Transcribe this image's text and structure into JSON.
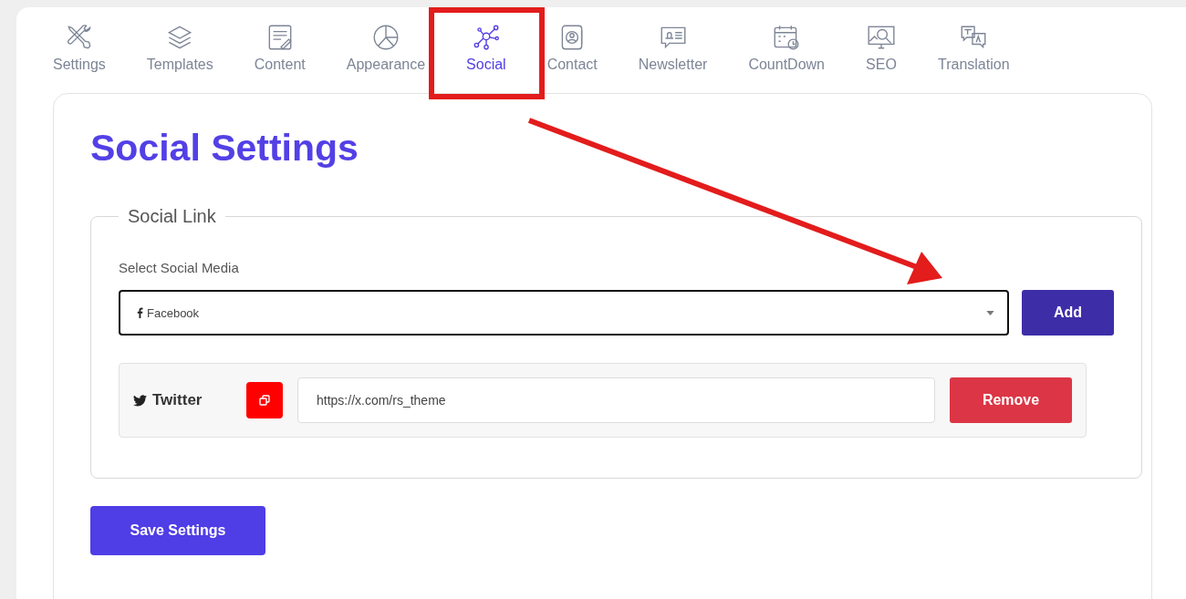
{
  "tabs": [
    {
      "label": "Settings",
      "selected": false
    },
    {
      "label": "Templates",
      "selected": false
    },
    {
      "label": "Content",
      "selected": false
    },
    {
      "label": "Appearance",
      "selected": false
    },
    {
      "label": "Social",
      "selected": true
    },
    {
      "label": "Contact",
      "selected": false
    },
    {
      "label": "Newsletter",
      "selected": false
    },
    {
      "label": "CountDown",
      "selected": false
    },
    {
      "label": "SEO",
      "selected": false
    },
    {
      "label": "Translation",
      "selected": false
    }
  ],
  "heading": "Social Settings",
  "social_link": {
    "legend": "Social Link",
    "select_label": "Select Social Media",
    "select_value": "Facebook",
    "add_button": "Add",
    "links": [
      {
        "name": "Twitter",
        "url": "https://x.com/rs_theme",
        "remove_button": "Remove"
      }
    ]
  },
  "save_button": "Save Settings"
}
